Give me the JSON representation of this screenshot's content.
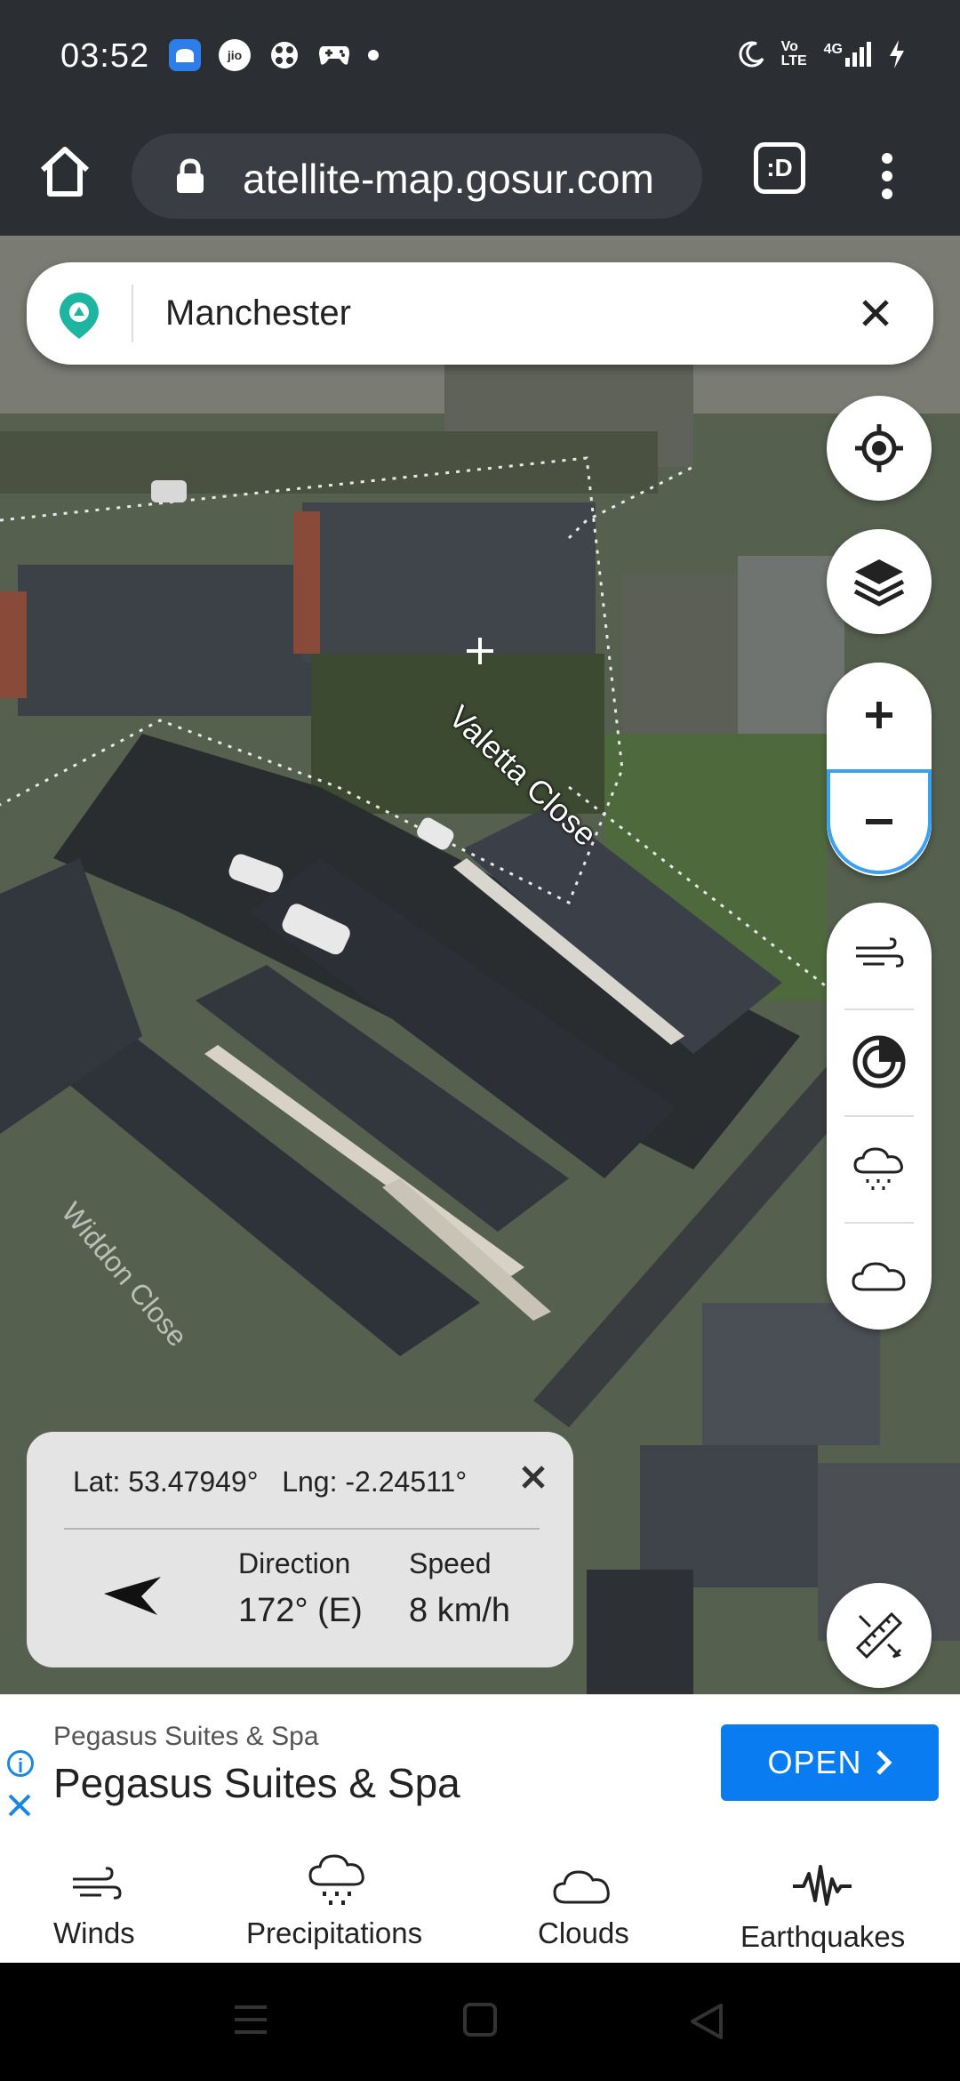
{
  "status_bar": {
    "time": "03:52",
    "left_icons": [
      "app-icon",
      "jio-icon",
      "game-icon",
      "controller-icon",
      "dot-icon"
    ],
    "right_icons": [
      "moon-icon",
      "volte-icon",
      "signal-4g-icon",
      "battery-charging-icon"
    ],
    "volte_text": "Vo LTE",
    "network_text": "4G"
  },
  "browser": {
    "url": "atellite-map.gosur.com",
    "tabs_label": ":D"
  },
  "search": {
    "value": "Manchester"
  },
  "map": {
    "street_label": "Valetta Close",
    "street_label_2": "Widdon Close"
  },
  "info_panel": {
    "latlng": "Lat: 53.47949°   Lng: -2.24511°",
    "direction_label": "Direction",
    "direction_value": "172° (E)",
    "speed_label": "Speed",
    "speed_value": "8 km/h"
  },
  "ad": {
    "small_text": "Pegasus Suites & Spa",
    "title": "Pegasus Suites & Spa",
    "open_label": "OPEN",
    "info_glyph": "i"
  },
  "bottom_nav": {
    "items": [
      {
        "label": "Winds",
        "icon": "wind-icon"
      },
      {
        "label": "Precipitations",
        "icon": "rain-cloud-icon"
      },
      {
        "label": "Clouds",
        "icon": "cloud-icon"
      },
      {
        "label": "Earthquakes",
        "icon": "seismograph-icon"
      }
    ]
  },
  "colors": {
    "accent_blue": "#0a7cf2",
    "logo_teal": "#1eb5a0",
    "status_bar_bg": "#2b2e33"
  }
}
